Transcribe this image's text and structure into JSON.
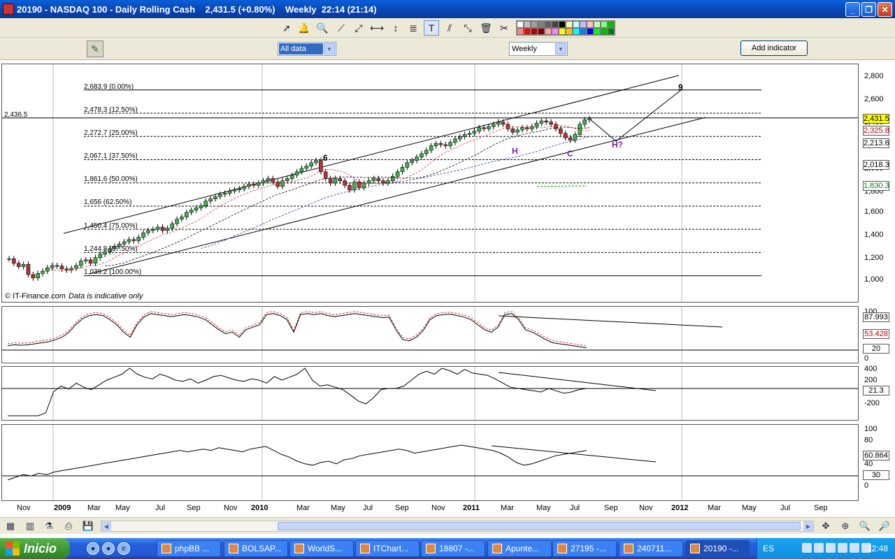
{
  "window": {
    "title": "20190 - NASDAQ 100 - Daily Rolling Cash    2,431.5 (+0.80%)    Weekly  22:14 (21:14)",
    "buttons": [
      "_",
      "❐",
      "✕"
    ]
  },
  "toolbar": {
    "tools": [
      "pointer-icon",
      "alert-bell-icon",
      "zoom-icon",
      "line-icon",
      "trendline-icon",
      "horizontal-line-icon",
      "vertical-line-icon",
      "fibonacci-icon",
      "text-icon",
      "parallel-channel-icon",
      "expand-icon",
      "trash-icon",
      "tools-icon"
    ],
    "palette": [
      "#ffffff",
      "#c0c0c0",
      "#a0a0a0",
      "#808080",
      "#606060",
      "#404040",
      "#000000",
      "#ffffc0",
      "#c0ffff",
      "#c0c0ff",
      "#ffc0c0",
      "#c0ffc0",
      "#80ff80",
      "#00c000",
      "#ff8080",
      "#ff0000",
      "#c00000",
      "#800000",
      "#ffa0a0",
      "#ff80ff",
      "#ffff00",
      "#ffc000",
      "#00ffff",
      "#0080ff",
      "#0000ff",
      "#00ff00",
      "#00c000",
      "#008000"
    ]
  },
  "controls": {
    "data_range": "All data",
    "period": "Weekly",
    "add_indicator": "Add indicator"
  },
  "main_chart": {
    "y_ticks": [
      "2,800",
      "2,600",
      "2,400",
      "2,200",
      "2,000",
      "1,800",
      "1,600",
      "1,400",
      "1,200",
      "1,000"
    ],
    "price_marker_left": "2,436.5",
    "price_boxes": [
      {
        "label": "2,431.5",
        "color": "#ffff00"
      },
      {
        "label": "2,325.8",
        "color": "#ffffff",
        "text_color": "#c00000"
      },
      {
        "label": "2,213.6",
        "color": "#ffffff"
      },
      {
        "label": "2,018.3",
        "color": "#ffffff"
      },
      {
        "label": "1,830.3",
        "color": "#ffffff",
        "text_color": "#008000"
      }
    ],
    "fib_levels": [
      "2,683.9 (0.00%)",
      "2,478.3 (12.50%)",
      "2,272.7 (25.00%)",
      "2,067.1 (37.50%)",
      "1,861.6 (50.00%)",
      "1,656 (62.50%)",
      "1,450.4 (75.00%)",
      "1,244.8 (87.50%)",
      "1,039.2 (100.00%)"
    ],
    "wave_labels": {
      "w6": "6",
      "w9": "9",
      "h": "H",
      "c": "C",
      "h_q": "H?"
    },
    "copyright": "© IT-Finance.com",
    "disclaimer": "Data is indicative only"
  },
  "indicator1": {
    "y_ticks": [
      "100",
      "0"
    ],
    "boxes": [
      {
        "label": "87.993"
      },
      {
        "label": "53.428",
        "text_color": "#c00000"
      },
      {
        "label": "20"
      }
    ]
  },
  "indicator2": {
    "y_ticks": [
      "400",
      "200",
      "-200"
    ],
    "boxes": [
      {
        "label": "21.3"
      }
    ]
  },
  "indicator3": {
    "y_ticks": [
      "100",
      "80",
      "40",
      "0"
    ],
    "boxes": [
      {
        "label": "60.864"
      },
      {
        "label": "30"
      }
    ]
  },
  "x_axis": {
    "labels": [
      "Nov",
      "2009",
      "Mar",
      "May",
      "Jul",
      "Sep",
      "Nov",
      "2010",
      "Mar",
      "May",
      "Jul",
      "Sep",
      "Nov",
      "2011",
      "Mar",
      "May",
      "Jul",
      "Sep",
      "Nov",
      "2012",
      "Mar",
      "May",
      "Jul",
      "Sep"
    ],
    "years": [
      "2009",
      "2010",
      "2011",
      "2012"
    ]
  },
  "bottom_toolbar": {
    "tools": [
      "chart-icon",
      "candles-icon",
      "indicator-icon",
      "print-icon",
      "save-icon"
    ],
    "zoom_tools": [
      "pan-icon",
      "zoom-select-icon",
      "zoom-out-icon",
      "zoom-in-icon"
    ]
  },
  "taskbar": {
    "start_label": "Inicio",
    "tasks": [
      {
        "label": "phpBB ...",
        "active": false
      },
      {
        "label": "BOLSAP...",
        "active": false
      },
      {
        "label": "WorldS...",
        "active": false
      },
      {
        "label": "ITChart...",
        "active": false
      },
      {
        "label": "18807 -...",
        "active": false
      },
      {
        "label": "Apunte...",
        "active": false
      },
      {
        "label": "27195 -...",
        "active": false
      },
      {
        "label": "240711...",
        "active": false
      },
      {
        "label": "20190 -...",
        "active": true
      }
    ],
    "language": "ES",
    "clock": "12:48"
  }
}
